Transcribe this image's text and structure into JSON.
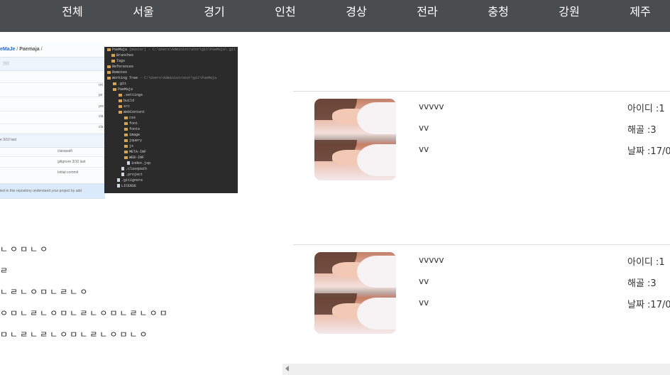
{
  "nav": {
    "items": [
      "전체",
      "서울",
      "경기",
      "인천",
      "경상",
      "전라",
      "충청",
      "강원",
      "제주"
    ]
  },
  "github": {
    "crumb_repo": "eMaJe",
    "crumb_sep": " / ",
    "crumb_name": "Paemaja",
    "crumb_tail": " /",
    "badge": "⋯",
    "side_labels": [
      "ort",
      "jar",
      "pro",
      "cla",
      "cla"
    ],
    "commit_row": "e 3/10 last",
    "files": [
      {
        "name": "classpath",
        "msg": ""
      },
      {
        "name": "gitignore 3/10 last",
        "msg": ""
      },
      {
        "name": "Initial commit",
        "msg": ""
      }
    ],
    "notice": "ted in this repository understand your project by add"
  },
  "tree": {
    "rows": [
      {
        "text": "PaeMaja",
        "note": "[master] - C:\\Users\\Administrator\\git\\PaeMaja\\.git",
        "icon": "folder"
      },
      {
        "text": "Branches",
        "note": "",
        "icon": "folder"
      },
      {
        "text": "Tags",
        "note": "",
        "icon": "folder"
      },
      {
        "text": "References",
        "note": "",
        "icon": "folder"
      },
      {
        "text": "Remotes",
        "note": "",
        "icon": "folder"
      },
      {
        "text": "Working Tree",
        "note": "- C:\\Users\\Administrator\\git\\PaeMaja",
        "icon": "folder"
      },
      {
        "text": ".git",
        "note": "",
        "icon": "folder"
      },
      {
        "text": "PaeMaja",
        "note": "",
        "icon": "folder"
      },
      {
        "text": ".settings",
        "note": "",
        "icon": "folder"
      },
      {
        "text": "build",
        "note": "",
        "icon": "folder"
      },
      {
        "text": "src",
        "note": "",
        "icon": "folder"
      },
      {
        "text": "WebContent",
        "note": "",
        "icon": "folder"
      },
      {
        "text": "css",
        "note": "",
        "icon": "folder"
      },
      {
        "text": "font",
        "note": "",
        "icon": "folder"
      },
      {
        "text": "fonts",
        "note": "",
        "icon": "folder"
      },
      {
        "text": "image",
        "note": "",
        "icon": "folder"
      },
      {
        "text": "jquery",
        "note": "",
        "icon": "folder"
      },
      {
        "text": "js",
        "note": "",
        "icon": "folder"
      },
      {
        "text": "META-INF",
        "note": "",
        "icon": "folder"
      },
      {
        "text": "WEB-INF",
        "note": "",
        "icon": "folder"
      },
      {
        "text": "index.jsp",
        "note": "",
        "icon": "file"
      },
      {
        "text": ".classpath",
        "note": "",
        "icon": "file"
      },
      {
        "text": ".project",
        "note": "",
        "icon": "file"
      },
      {
        "text": ".gitignore",
        "note": "",
        "icon": "file"
      },
      {
        "text": "LICENSE",
        "note": "",
        "icon": "file"
      }
    ]
  },
  "post_text": [
    "ㄴㅇㅁㄴㅇ",
    "ㄹ",
    "ㄴㄹㄴㅇㅁㄴㄹㄴㅇ",
    "ㅇㅁㄴㄹㄴㅇㅁㄴㄹㄴㅇㅁㄴㄹㄴㅇㅁ",
    "ㅁㄴㄹㄴㄹㄴㅇㅁㄴㄹㄴㅇㅁㄴㅇ"
  ],
  "cards": [
    {
      "title": "vvvvv",
      "line2": "vv",
      "line3": "vv",
      "id_label": "아이디 :1",
      "bones": "해골 :3",
      "date": "날짜 :17/0"
    },
    {
      "title": "vvvvv",
      "line2": "vv",
      "line3": "vv",
      "id_label": "아이디 :1",
      "bones": "해골 :3",
      "date": "날짜 :17/0"
    }
  ]
}
